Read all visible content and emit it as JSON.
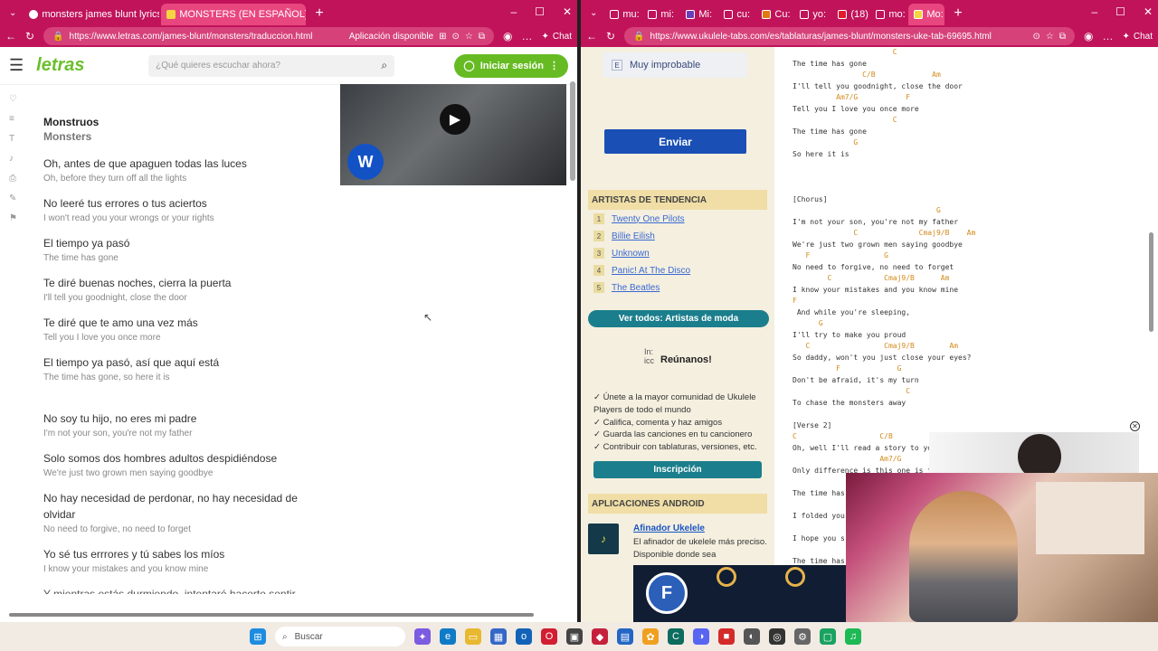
{
  "left": {
    "tabs": [
      {
        "label": "monsters james blunt lyrics españ",
        "active": false
      },
      {
        "label": "MONSTERS (EN ESPAÑOL) - James",
        "active": true
      }
    ],
    "url": "https://www.letras.com/james-blunt/monsters/traduccion.html",
    "app_available": "Aplicación disponible",
    "chat_label": "Chat",
    "logo": "letras",
    "search_placeholder": "¿Qué quieres escuchar ahora?",
    "login_label": "Iniciar sesión",
    "title_es": "Monstruos",
    "title_en": "Monsters",
    "lyrics": [
      {
        "es": "Oh, antes de que apaguen todas las luces",
        "en": "Oh, before they turn off all the lights"
      },
      {
        "es": "No leeré tus errores o tus aciertos",
        "en": "I won't read you your wrongs or your rights"
      },
      {
        "es": "El tiempo ya pasó",
        "en": "The time has gone"
      },
      {
        "es": "Te diré buenas noches, cierra la puerta",
        "en": "I'll tell you goodnight, close the door"
      },
      {
        "es": "Te diré que te amo una vez más",
        "en": "Tell you I love you once more"
      },
      {
        "es": "El tiempo ya pasó, así que aquí está",
        "en": "The time has gone, so here it is"
      }
    ],
    "lyrics2": [
      {
        "es": "No soy tu hijo, no eres mi padre",
        "en": "I'm not your son, you're not my father"
      },
      {
        "es": "Solo somos dos hombres adultos despidiéndose",
        "en": "We're just two grown men saying goodbye"
      },
      {
        "es": "No hay necesidad de perdonar, no hay necesidad de olvidar",
        "en": "No need to forgive, no need to forget"
      },
      {
        "es": "Yo sé tus errrores y tú sabes los míos",
        "en": "I know your mistakes and you know mine"
      }
    ],
    "cut_line": "Y mientras estás durmiendo, intentaré hacerte sentir"
  },
  "right": {
    "tabs": [
      "mu:",
      "mi:",
      "Mi:",
      "cu:",
      "Cu:",
      "yo:",
      "(18)",
      "mo:",
      "Mo:"
    ],
    "url": "https://www.ukulele-tabs.com/es/tablaturas/james-blunt/monsters-uke-tab-69695.html",
    "chat_label": "Chat",
    "improbable": "Muy improbable",
    "enviar": "Enviar",
    "trending_header": "ARTISTAS DE TENDENCIA",
    "trending": [
      "Twenty One Pilots",
      "Billie Eilish",
      "Unknown",
      "Panic! At The Disco",
      "The Beatles"
    ],
    "see_all": "Ver todos: Artistas de moda",
    "join_title": "Reúnanos!",
    "join_img_alt": "In: icc",
    "join_lines": [
      "✓ Únete a la mayor comunidad de Ukulele",
      "Players de todo el mundo",
      "✓ Califica, comenta y haz amigos",
      "✓ Guarda las canciones en tu cancionero",
      "✓ Contribuir con tablaturas, versiones, etc."
    ],
    "signup": "Inscripción",
    "apps_header": "APLICACIONES ANDROID",
    "app_name": "Afinador Ukelele",
    "app_desc": "El afinador de ukelele más preciso. Disponible donde sea",
    "tab_lines": [
      {
        "t": "                       C",
        "c": true
      },
      {
        "t": "The time has gone",
        "c": false
      },
      {
        "t": "                C/B             Am",
        "c": true
      },
      {
        "t": "I'll tell you goodnight, close the door",
        "c": false
      },
      {
        "t": "          Am7/G           F",
        "c": true
      },
      {
        "t": "Tell you I love you once more",
        "c": false
      },
      {
        "t": "                       C",
        "c": true
      },
      {
        "t": "The time has gone",
        "c": false
      },
      {
        "t": "              G",
        "c": true
      },
      {
        "t": "So here it is",
        "c": false
      },
      {
        "t": "",
        "c": false
      },
      {
        "t": "",
        "c": false
      },
      {
        "t": "",
        "c": false
      },
      {
        "t": "[Chorus]",
        "c": false
      },
      {
        "t": "                                 G",
        "c": true
      },
      {
        "t": "I'm not your son, you're not my father",
        "c": false
      },
      {
        "t": "              C              Cmaj9/B    Am",
        "c": true
      },
      {
        "t": "We're just two grown men saying goodbye",
        "c": false
      },
      {
        "t": "   F                 G",
        "c": true
      },
      {
        "t": "No need to forgive, no need to forget",
        "c": false
      },
      {
        "t": "        C            Cmaj9/B      Am",
        "c": true
      },
      {
        "t": "I know your mistakes and you know mine",
        "c": false
      },
      {
        "t": "F",
        "c": true
      },
      {
        "t": " And while you're sleeping,",
        "c": false
      },
      {
        "t": "      G",
        "c": true
      },
      {
        "t": "I'll try to make you proud",
        "c": false
      },
      {
        "t": "   C                 Cmaj9/B        Am",
        "c": true
      },
      {
        "t": "So daddy, won't you just close your eyes?",
        "c": false
      },
      {
        "t": "          F             G",
        "c": true
      },
      {
        "t": "Don't be afraid, it's my turn",
        "c": false
      },
      {
        "t": "                          C",
        "c": true
      },
      {
        "t": "To chase the monsters away",
        "c": false
      },
      {
        "t": "",
        "c": false
      },
      {
        "t": "[Verse 2]",
        "c": false
      },
      {
        "t": "C                   C/B",
        "c": true
      },
      {
        "t": "Oh, well I'll read a story to yo",
        "c": false
      },
      {
        "t": "                    Am7/G",
        "c": true
      },
      {
        "t": "Only difference is this one is t",
        "c": false
      },
      {
        "t": "",
        "c": false
      },
      {
        "t": "The time has",
        "c": false
      },
      {
        "t": "",
        "c": false
      },
      {
        "t": "I folded you",
        "c": false
      },
      {
        "t": "",
        "c": false
      },
      {
        "t": "I hope you s",
        "c": false
      },
      {
        "t": "",
        "c": false
      },
      {
        "t": "The time has",
        "c": false
      }
    ]
  },
  "taskbar": {
    "search_label": "Buscar"
  },
  "colors": {
    "browser_frame": "#c0135a",
    "letras_green": "#66bb22",
    "enviar_blue": "#1a4fb5",
    "teal": "#1b7e8c",
    "chord_orange": "#d4891a"
  }
}
